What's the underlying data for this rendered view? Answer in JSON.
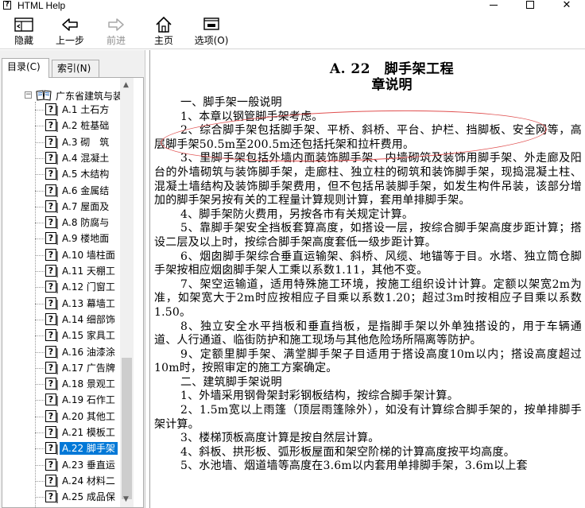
{
  "window": {
    "title": "HTML Help",
    "controls": {
      "close": "✕"
    }
  },
  "toolbar": {
    "hide": "隐藏",
    "back": "上一步",
    "forward": "前进",
    "home": "主页",
    "options": "选项(O)"
  },
  "tabs": {
    "contents": "目录(C)",
    "index": "索引(N)"
  },
  "tree": {
    "root": "广东省建筑与装",
    "items": [
      {
        "code": "A.1",
        "title": "土石方"
      },
      {
        "code": "A.2",
        "title": "桩基础"
      },
      {
        "code": "A.3",
        "title": "砌　筑"
      },
      {
        "code": "A.4",
        "title": "混凝土"
      },
      {
        "code": "A.5",
        "title": "木结构"
      },
      {
        "code": "A.6",
        "title": "金属结"
      },
      {
        "code": "A.7",
        "title": "屋面及"
      },
      {
        "code": "A.8",
        "title": "防腐与"
      },
      {
        "code": "A.9",
        "title": "楼地面"
      },
      {
        "code": "A.10",
        "title": "墙柱面"
      },
      {
        "code": "A.11",
        "title": "天棚工"
      },
      {
        "code": "A.12",
        "title": "门窗工"
      },
      {
        "code": "A.13",
        "title": "幕墙工"
      },
      {
        "code": "A.14",
        "title": "细部饰"
      },
      {
        "code": "A.15",
        "title": "家具工"
      },
      {
        "code": "A.16",
        "title": "油漆涂"
      },
      {
        "code": "A.17",
        "title": "广告牌"
      },
      {
        "code": "A.18",
        "title": "景观工"
      },
      {
        "code": "A.19",
        "title": "石作工"
      },
      {
        "code": "A.20",
        "title": "其他工"
      },
      {
        "code": "A.21",
        "title": "模板工"
      },
      {
        "code": "A.22",
        "title": "脚手架"
      },
      {
        "code": "A.23",
        "title": "垂直运"
      },
      {
        "code": "A.24",
        "title": "材料二"
      },
      {
        "code": "A.25",
        "title": "成品保"
      }
    ],
    "selected_index": 21
  },
  "document": {
    "title": "A. 22　脚手架工程",
    "subtitle": "章说明",
    "paragraphs": [
      "一、脚手架一般说明",
      "1、本章以钢管脚手架考虑。",
      "2、综合脚手架包括脚手架、平桥、斜桥、平台、护栏、挡脚板、安全网等，高层脚手架50.5m至200.5m还包括托架和拉杆费用。",
      "3、里脚手架包括外墙内面装饰脚手架、内墙砌筑及装饰用脚手架、外走廊及阳台的外墙砌筑与装饰脚手架，走廊柱、独立柱的砌筑和装饰脚手架，现捣混凝土柱、混凝土墙结构及装饰脚手架费用，但不包括吊装脚手架，如发生构件吊装，该部分增加的脚手架另按有关的工程量计算规则计算，套用单排脚手架。",
      "4、脚手架防火费用，另按各市有关规定计算。",
      "5、靠脚手架安全挡板套算高度，如搭设一层，按综合脚手架高度步距计算；搭设二层及以上时，按综合脚手架高度套低一级步距计算。",
      "6、烟囱脚手架综合垂直运输架、斜桥、风缆、地锚等于目。水塔、独立筒仓脚手架按相应烟囱脚手架人工乘以系数1.11，其他不变。",
      "7、架空运输道，适用特殊施工环境，按施工组织设计计算。定额以架宽2m为准，如架宽大于2m时应按相应子目乘以系数1.20；超过3m时按相应子目乘以系数1.50。",
      "8、独立安全水平挡板和垂直挡板，是指脚手架以外单独搭设的，用于车辆通道、人行通道、临街防护和施工现场与其他危险场所隔离等防护。",
      "9、定额里脚手架、满堂脚手架子目适用于搭设高度10m以内；搭设高度超过10m时，按照审定的施工方案确定。",
      "二、建筑脚手架说明",
      "1、外墙采用钢骨架封彩钢板结构，按综合脚手架计算。",
      "2、1.5m宽以上雨篷（顶层雨篷除外），如没有计算综合脚手架的，按单排脚手架计算。",
      "3、楼梯顶板高度计算是按自然层计算。",
      "4、斜板、拱形板、弧形板屋面和架空阶梯的计算高度按平均高度。",
      "5、水池墙、烟道墙等高度在3.6m以内套用单排脚手架，3.6m以上套"
    ]
  }
}
